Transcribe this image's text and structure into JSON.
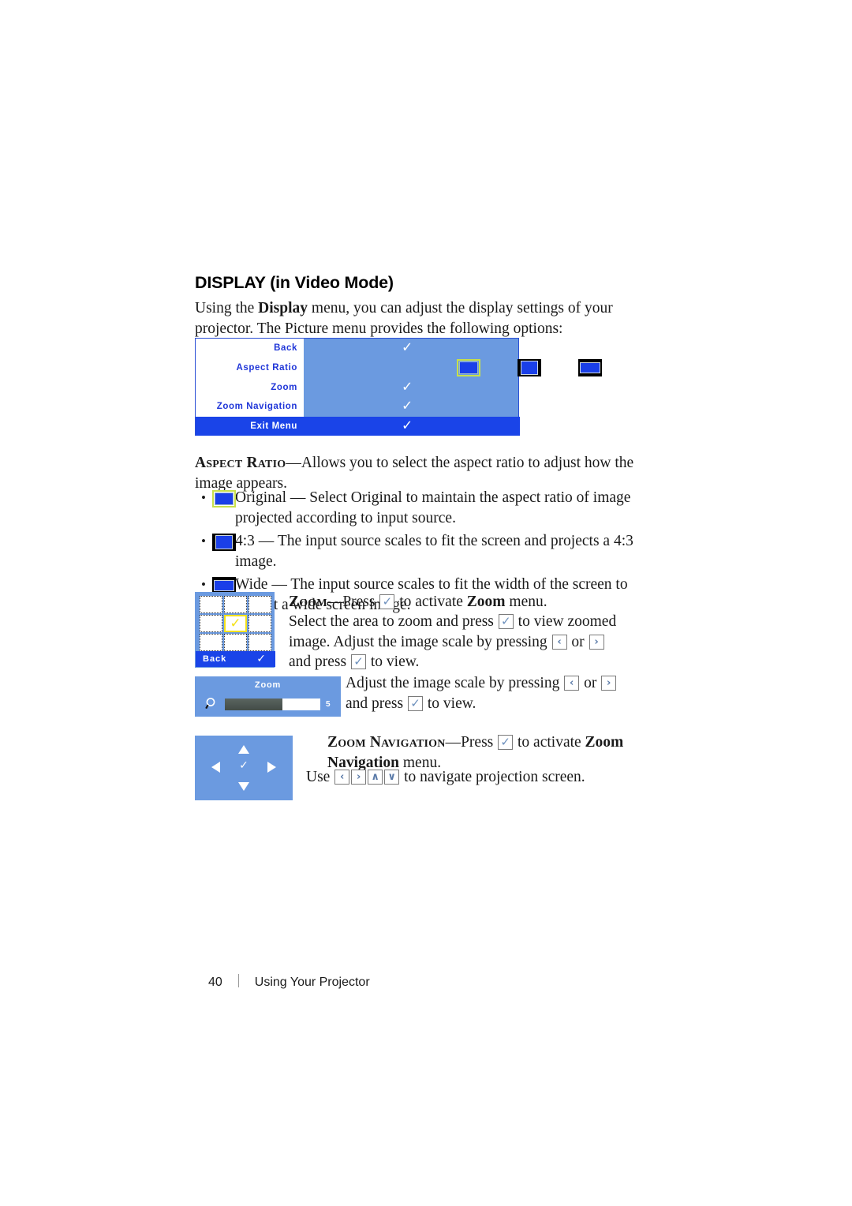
{
  "heading": "DISPLAY (in Video Mode)",
  "intro": {
    "before": "Using the ",
    "bold": "Display",
    "after": " menu, you can adjust the display settings of your projector. The Picture menu provides the following options:"
  },
  "osd_menu": {
    "rows": [
      {
        "label": "Back",
        "value_icon": "check-icon"
      },
      {
        "label": "Aspect Ratio",
        "value_icon": "aspect-ratio-icons"
      },
      {
        "label": "Zoom",
        "value_icon": "check-icon"
      },
      {
        "label": "Zoom Navigation",
        "value_icon": "check-icon"
      }
    ],
    "exit_label": "Exit Menu",
    "check_glyph": "✓",
    "aspect_icons": [
      "original",
      "4:3",
      "wide"
    ],
    "colors": {
      "panel_blue": "#6b9ae0",
      "exit_blue": "#1a44e8",
      "label_blue": "#2036d8",
      "selection_yellow": "#c8e04b",
      "screen_blue": "#1a3fe8"
    }
  },
  "aspect_ratio": {
    "term": "Aspect Ratio",
    "dash": "—",
    "description": "Allows you to select the aspect ratio to adjust how the image appears.",
    "bullets": [
      {
        "icon": "aspect-original-icon",
        "text": "Original — Select Original to maintain the aspect ratio of image projected according to input source."
      },
      {
        "icon": "aspect-4-3-icon",
        "text": "4:3 — The input source scales to fit the screen and projects a 4:3 image."
      },
      {
        "icon": "aspect-wide-icon",
        "text": "Wide — The input source scales to fit the width of the screen to project a wide screen image."
      }
    ]
  },
  "zoom": {
    "term": "Zoom",
    "dash": "—",
    "line1_a": "Press ",
    "line1_b": " to activate ",
    "line1_bold": "Zoom",
    "line1_c": " menu.",
    "line2_a": "Select the area to zoom and press ",
    "line2_b": " to view zoomed image.",
    "line3_a": "Adjust the image scale by pressing ",
    "line3_or": " or ",
    "line3_b": " and press ",
    "line3_c": " to view.",
    "grid": {
      "back_label": "Back",
      "check_glyph": "✓",
      "center_check_glyph": "✓",
      "cells": 9,
      "selected_cell_index": 4
    },
    "slider": {
      "title": "Zoom",
      "value": "5",
      "fill_percent": 60,
      "icon": "magnifier-icon"
    },
    "slider_text_a": "Adjust the image scale by pressing ",
    "slider_text_or": " or ",
    "slider_text_b": " and press ",
    "slider_text_c": " to view."
  },
  "zoom_navigation": {
    "term": "Zoom Navigation",
    "dash": "—",
    "line1_a": "Press ",
    "line1_b": " to activate ",
    "line1_bold": "Zoom Navigation",
    "line1_c": " menu.",
    "line2_a": "Use ",
    "line2_b": " to navigate projection screen.",
    "pad": {
      "center_glyph": "✓",
      "arrows": [
        "up",
        "down",
        "left",
        "right"
      ]
    }
  },
  "keys": {
    "enter": "✓",
    "left": "‹",
    "right": "›",
    "up": "∧",
    "down": "∨"
  },
  "footer": {
    "page_number": "40",
    "section": "Using Your Projector"
  }
}
